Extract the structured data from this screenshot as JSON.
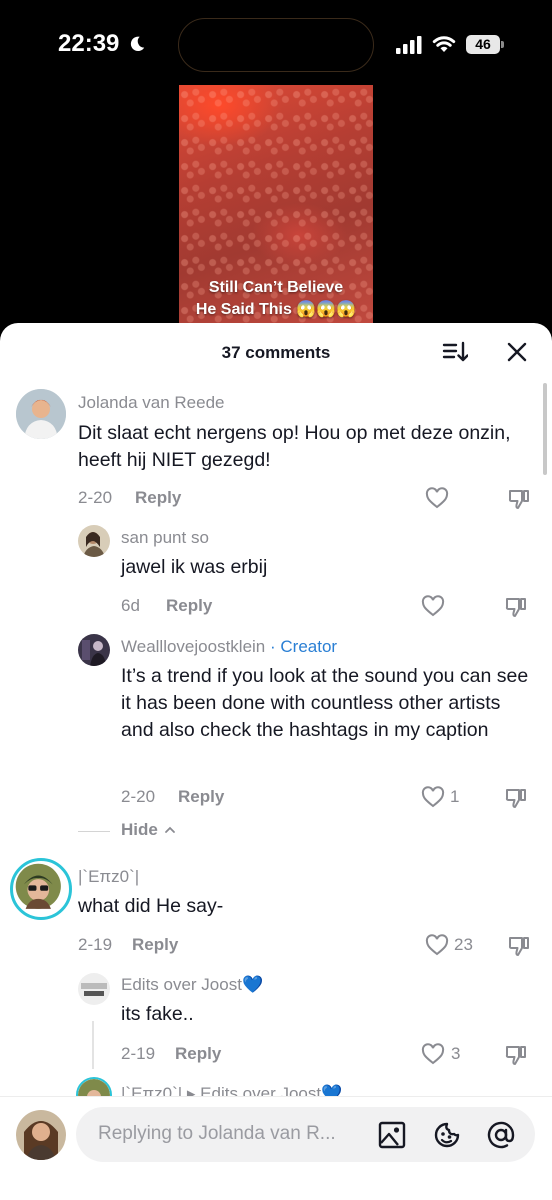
{
  "status_bar": {
    "time": "22:39",
    "battery": "46"
  },
  "video": {
    "caption_line1": "Still Can’t Believe",
    "caption_line2": "He Said This 😱😱😱"
  },
  "sheet": {
    "title": "37 comments",
    "sort_icon": "sort-icon",
    "close_icon": "close-icon"
  },
  "comments": [
    {
      "name": "Jolanda van Reede",
      "text": "Dit slaat echt nergens op! Hou op met deze onzin, heeft hij NIET gezegd!",
      "date": "2-20",
      "reply": "Reply",
      "likes": ""
    },
    {
      "name": "san punt so",
      "text": "jawel ik was erbij",
      "date": "6d",
      "reply": "Reply",
      "likes": ""
    },
    {
      "name": "Wealllovejoostklein",
      "badge": "· Creator",
      "text": "It’s a trend if you look at the sound you can see it has been done with countless other artists and also check the hashtags in my caption",
      "date": "2-20",
      "reply": "Reply",
      "likes": "1"
    },
    {
      "name": "|`Eπz0`|",
      "text": "what did He say-",
      "date": "2-19",
      "reply": "Reply",
      "likes": "23"
    },
    {
      "name": "Edits over Joost💙",
      "text": "its fake..",
      "date": "2-19",
      "reply": "Reply",
      "likes": "3"
    },
    {
      "name": "|`Eπz0`| ▸ Edits over Joost💙"
    }
  ],
  "hide_label": "Hide",
  "composer": {
    "placeholder": "Replying to Jolanda van R..."
  },
  "colors": {
    "creator": "#2a7fd4",
    "muted": "#8a8b91",
    "story_ring": "#2bc4d8"
  }
}
